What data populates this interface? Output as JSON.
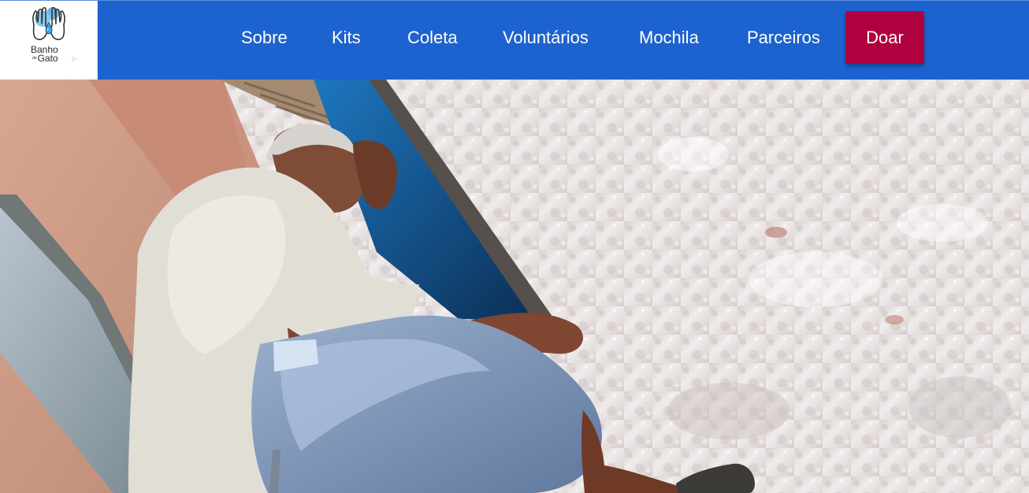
{
  "header": {
    "logo": {
      "line1": "Banho",
      "small": "de",
      "line2": "Gato",
      "icon": "hands-drop-icon",
      "alt_icon": "small-arrow-icon"
    },
    "nav": [
      {
        "label": "Sobre"
      },
      {
        "label": "Kits"
      },
      {
        "label": "Coleta"
      },
      {
        "label": "Voluntários"
      },
      {
        "label": "Mochila"
      },
      {
        "label": "Parceiros"
      }
    ],
    "donate_label": "Doar",
    "colors": {
      "header_blue": "#1d63cf",
      "donate_red": "#b0003f",
      "logo_blue": "#69b6ea"
    }
  },
  "hero": {
    "image": "photo of man sitting against a wall"
  }
}
